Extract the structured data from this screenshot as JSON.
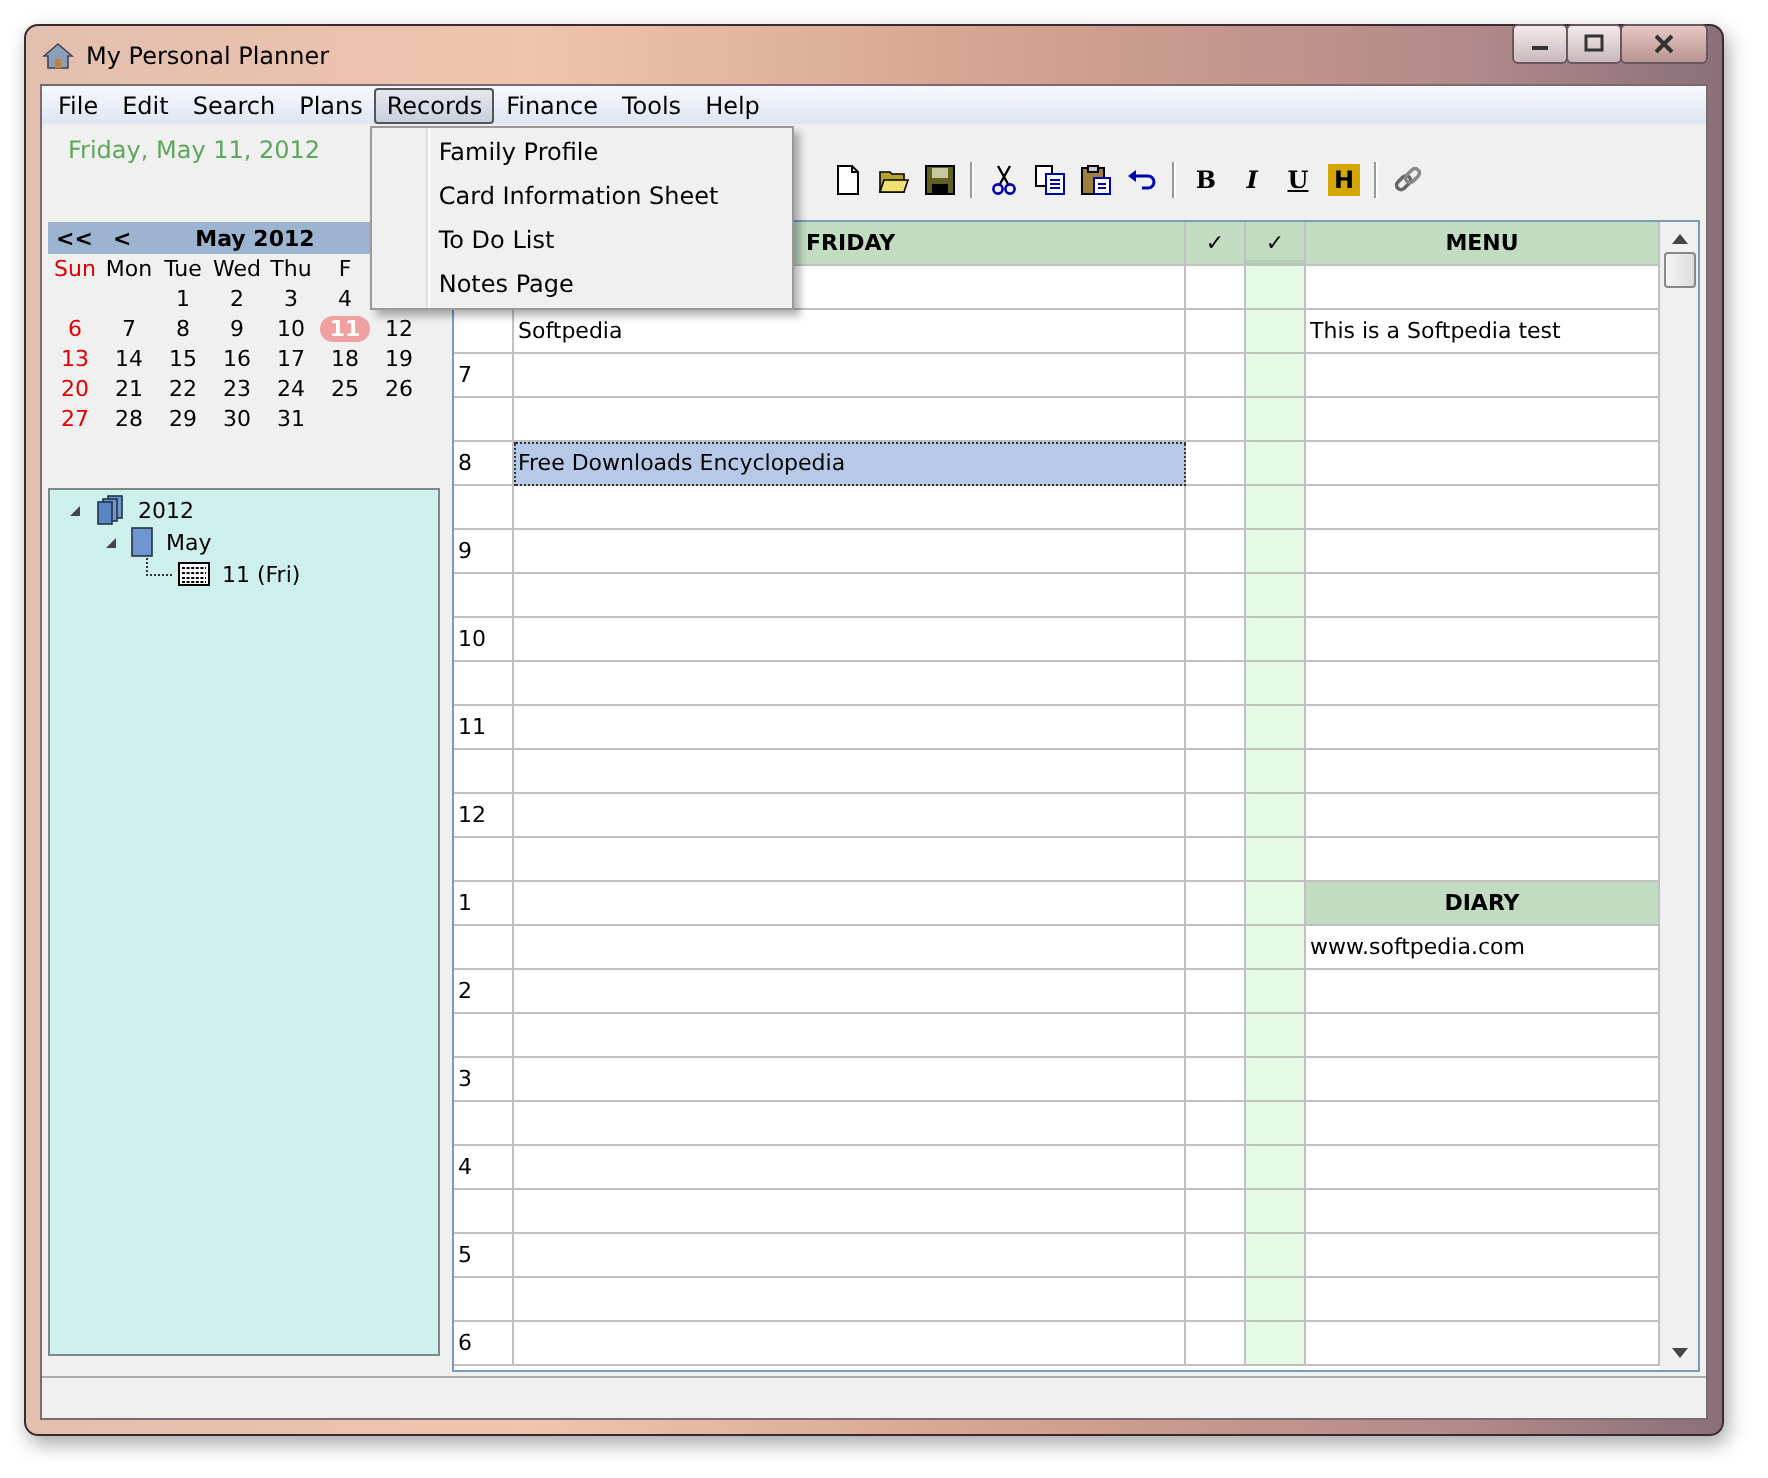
{
  "window": {
    "title": "My Personal Planner"
  },
  "menu_bar": [
    {
      "label": "File",
      "selected": false
    },
    {
      "label": "Edit",
      "selected": false
    },
    {
      "label": "Search",
      "selected": false
    },
    {
      "label": "Plans",
      "selected": false
    },
    {
      "label": "Records",
      "selected": true
    },
    {
      "label": "Finance",
      "selected": false
    },
    {
      "label": "Tools",
      "selected": false
    },
    {
      "label": "Help",
      "selected": false
    }
  ],
  "records_menu": [
    {
      "label": "Family Profile"
    },
    {
      "label": "Card Information Sheet"
    },
    {
      "label": "To Do List"
    },
    {
      "label": "Notes Page"
    }
  ],
  "date_heading": "Friday, May 11, 2012",
  "calendar": {
    "nav": [
      "<<",
      "<"
    ],
    "month": "May 2012",
    "weekdays": [
      "Sun",
      "Mon",
      "Tue",
      "Wed",
      "Thu",
      "F"
    ],
    "weeks": [
      [
        {
          "kind": "blank"
        },
        {
          "kind": "blank"
        },
        {
          "kind": "day",
          "day": "1",
          "selected": false
        },
        {
          "kind": "day",
          "day": "2",
          "selected": false
        },
        {
          "kind": "day",
          "day": "3",
          "selected": false
        },
        {
          "kind": "day",
          "day": "4",
          "selected": false
        }
      ],
      [
        {
          "kind": "day",
          "day": "6",
          "selected": false
        },
        {
          "kind": "day",
          "day": "7",
          "selected": false
        },
        {
          "kind": "day",
          "day": "8",
          "selected": false
        },
        {
          "kind": "day",
          "day": "9",
          "selected": false
        },
        {
          "kind": "day",
          "day": "10",
          "selected": false
        },
        {
          "kind": "day",
          "day": "11",
          "selected": true
        },
        {
          "kind": "day",
          "day": "12",
          "selected": false
        }
      ],
      [
        {
          "kind": "day",
          "day": "13",
          "selected": false
        },
        {
          "kind": "day",
          "day": "14",
          "selected": false
        },
        {
          "kind": "day",
          "day": "15",
          "selected": false
        },
        {
          "kind": "day",
          "day": "16",
          "selected": false
        },
        {
          "kind": "day",
          "day": "17",
          "selected": false
        },
        {
          "kind": "day",
          "day": "18",
          "selected": false
        },
        {
          "kind": "day",
          "day": "19",
          "selected": false
        }
      ],
      [
        {
          "kind": "day",
          "day": "20",
          "selected": false
        },
        {
          "kind": "day",
          "day": "21",
          "selected": false
        },
        {
          "kind": "day",
          "day": "22",
          "selected": false
        },
        {
          "kind": "day",
          "day": "23",
          "selected": false
        },
        {
          "kind": "day",
          "day": "24",
          "selected": false
        },
        {
          "kind": "day",
          "day": "25",
          "selected": false
        },
        {
          "kind": "day",
          "day": "26",
          "selected": false
        }
      ],
      [
        {
          "kind": "day",
          "day": "27",
          "selected": false
        },
        {
          "kind": "day",
          "day": "28",
          "selected": false
        },
        {
          "kind": "day",
          "day": "29",
          "selected": false
        },
        {
          "kind": "day",
          "day": "30",
          "selected": false
        },
        {
          "kind": "day",
          "day": "31",
          "selected": false
        }
      ]
    ]
  },
  "tree": [
    {
      "label": "2012",
      "kind": "year",
      "expanded": true,
      "children": [
        {
          "label": "May",
          "kind": "month",
          "expanded": true,
          "children": [
            {
              "label": "11 (Fri)",
              "kind": "day"
            }
          ]
        }
      ]
    }
  ],
  "toolbar": [
    {
      "kind": "new"
    },
    {
      "kind": "open"
    },
    {
      "kind": "save"
    },
    {
      "kind": "separator"
    },
    {
      "kind": "cut"
    },
    {
      "kind": "copy"
    },
    {
      "kind": "paste"
    },
    {
      "kind": "undo"
    },
    {
      "kind": "separator"
    },
    {
      "kind": "bold",
      "label": "B"
    },
    {
      "kind": "italic",
      "label": "I"
    },
    {
      "kind": "underline",
      "label": "U"
    },
    {
      "kind": "highlight",
      "label": "H"
    },
    {
      "kind": "separator"
    },
    {
      "kind": "link"
    }
  ],
  "grid": {
    "columns": [
      {
        "label": "FRIDAY",
        "shaded": false
      },
      {
        "label": "✓",
        "shaded": false
      },
      {
        "label": "✓",
        "shaded": true
      },
      {
        "label": "MENU",
        "shaded": false
      }
    ],
    "rows": [
      {
        "selected": false
      },
      {
        "entry": "Softpedia",
        "selected": false,
        "side": {
          "kind": "text",
          "text": "This is a Softpedia test"
        }
      },
      {
        "hour": "7",
        "selected": false
      },
      {
        "selected": false
      },
      {
        "hour": "8",
        "entry": "Free Downloads Encyclopedia",
        "selected": true
      },
      {
        "selected": false
      },
      {
        "hour": "9",
        "selected": false
      },
      {
        "selected": false
      },
      {
        "hour": "10",
        "selected": false
      },
      {
        "selected": false
      },
      {
        "hour": "11",
        "selected": false
      },
      {
        "selected": false
      },
      {
        "hour": "12",
        "selected": false
      },
      {
        "selected": false
      },
      {
        "hour": "1",
        "selected": false,
        "side": {
          "kind": "header",
          "text": "DIARY"
        }
      },
      {
        "selected": false,
        "side": {
          "kind": "text",
          "text": "www.softpedia.com"
        }
      },
      {
        "hour": "2",
        "selected": false
      },
      {
        "selected": false
      },
      {
        "hour": "3",
        "selected": false
      },
      {
        "selected": false
      },
      {
        "hour": "4",
        "selected": false
      },
      {
        "selected": false
      },
      {
        "hour": "5",
        "selected": false
      },
      {
        "selected": false
      },
      {
        "hour": "6",
        "selected": false
      }
    ]
  }
}
